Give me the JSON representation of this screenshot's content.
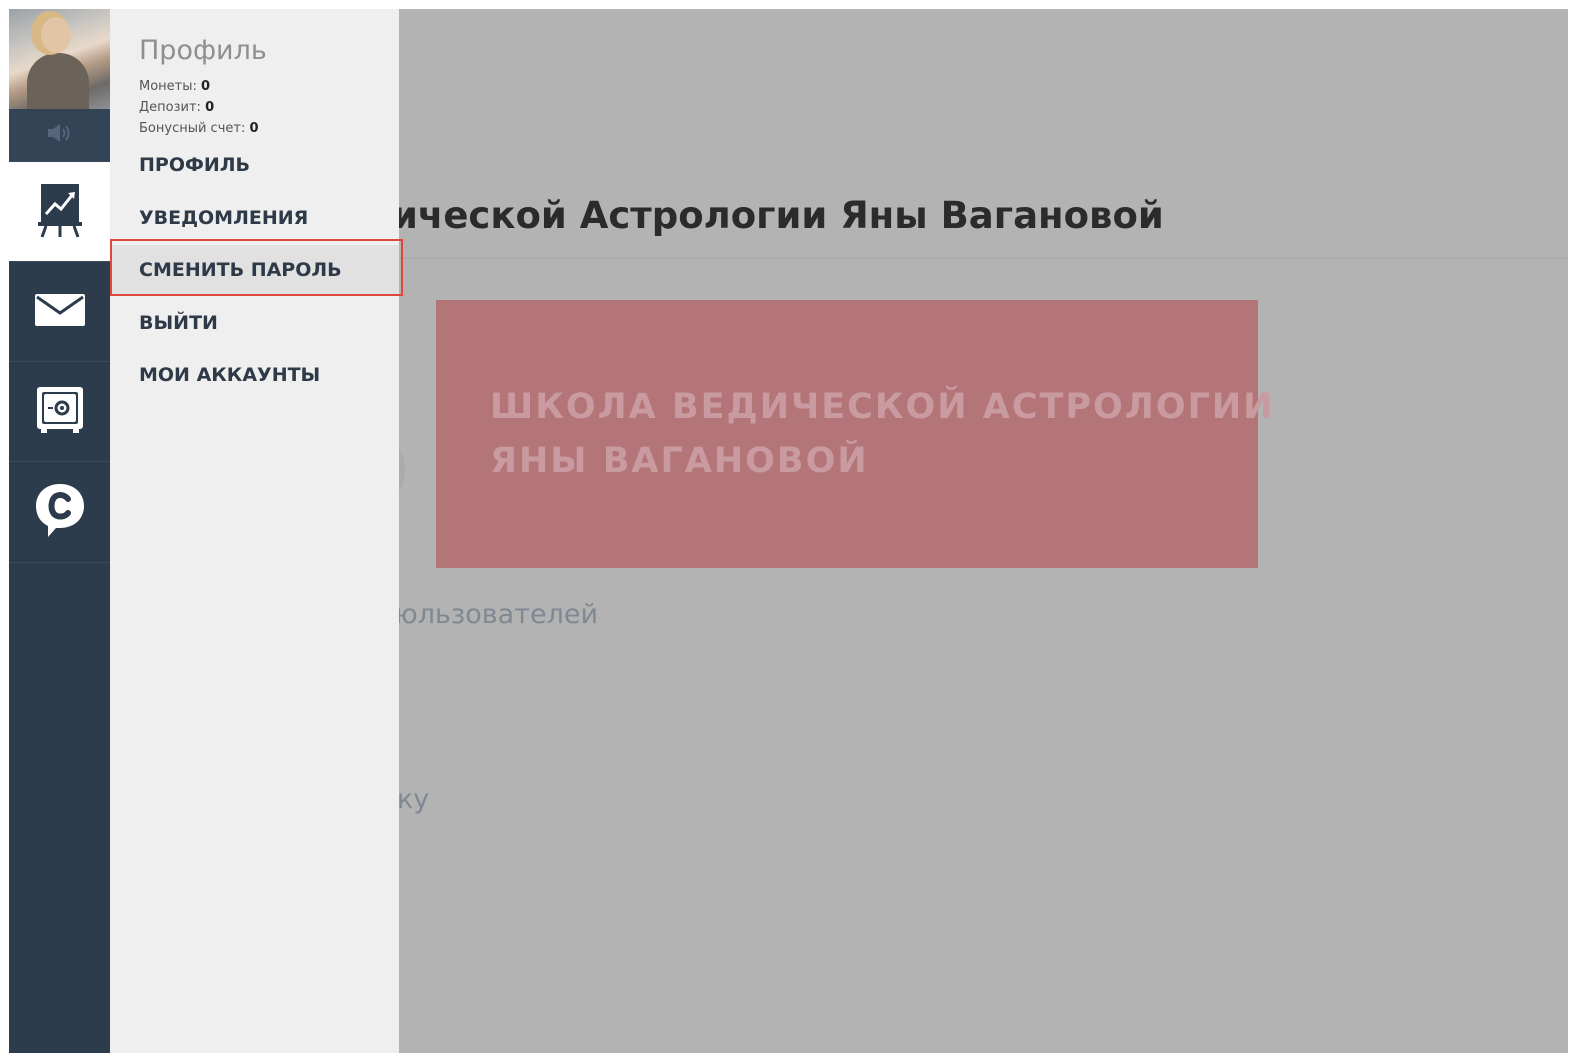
{
  "background_page": {
    "title_fragment": "ической Астрологии Яны Вагановой",
    "banner_line1": "ШКОЛА ВЕДИЧЕСКОЙ АСТРОЛОГИИ",
    "banner_line2": "ЯНЫ ВАГАНОВОЙ",
    "users_fragment": "юльзователей",
    "ky_fragment": "ку"
  },
  "sidebar": {
    "items": [
      {
        "name": "sound",
        "icon": "speaker-icon"
      },
      {
        "name": "chart",
        "icon": "chart-board-icon",
        "active": true
      },
      {
        "name": "mail",
        "icon": "envelope-icon"
      },
      {
        "name": "safe",
        "icon": "safe-icon"
      },
      {
        "name": "chat",
        "icon": "chat-c-icon"
      }
    ]
  },
  "profile_menu": {
    "title": "Профиль",
    "stats": [
      {
        "label": "Монеты:",
        "value": "0"
      },
      {
        "label": "Депозит:",
        "value": "0"
      },
      {
        "label": "Бонусный счет:",
        "value": "0"
      }
    ],
    "items": [
      {
        "label": "ПРОФИЛЬ"
      },
      {
        "label": "УВЕДОМЛЕНИЯ"
      },
      {
        "label": "СМЕНИТЬ ПАРОЛЬ",
        "highlighted": true
      },
      {
        "label": "ВЫЙТИ"
      },
      {
        "label": "МОИ АККАУНТЫ"
      }
    ]
  },
  "colors": {
    "rail": "#2d3c4d",
    "panel": "#efefef",
    "overlay": "#b3b3b3",
    "highlight_outline": "#e0473a",
    "banner": "#b47579"
  }
}
